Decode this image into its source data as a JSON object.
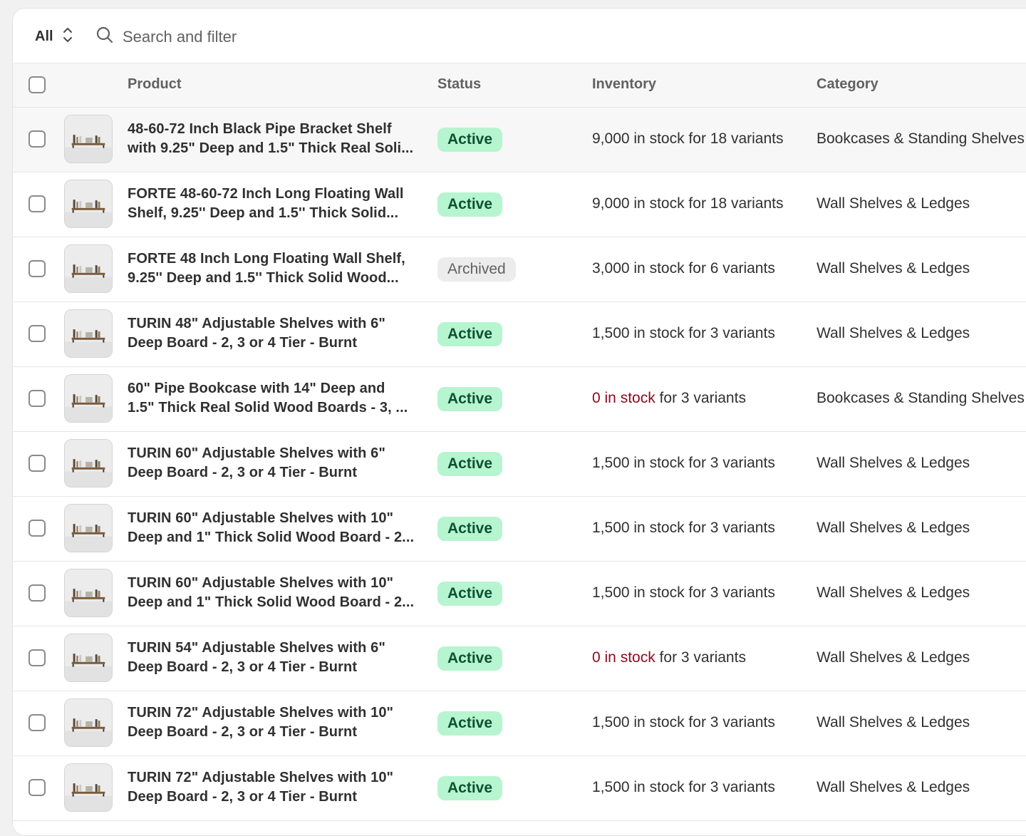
{
  "toolbar": {
    "view_label": "All",
    "search_placeholder": "Search and filter"
  },
  "table": {
    "headers": {
      "product": "Product",
      "status": "Status",
      "inventory": "Inventory",
      "category": "Category"
    },
    "rows": [
      {
        "title_line1": "48-60-72 Inch Black Pipe Bracket Shelf",
        "title_line2": "with 9.25\" Deep and 1.5\" Thick Real Soli...",
        "status": "Active",
        "stock": "9,000 in stock",
        "variants": " for 18 variants",
        "category": "Bookcases & Standing Shelves"
      },
      {
        "title_line1": "FORTE 48-60-72 Inch Long Floating Wall",
        "title_line2": "Shelf, 9.25'' Deep and 1.5'' Thick Solid...",
        "status": "Active",
        "stock": "9,000 in stock",
        "variants": " for 18 variants",
        "category": "Wall Shelves & Ledges"
      },
      {
        "title_line1": "FORTE 48 Inch Long Floating Wall Shelf,",
        "title_line2": "9.25'' Deep and 1.5'' Thick Solid Wood...",
        "status": "Archived",
        "stock": "3,000 in stock",
        "variants": " for 6 variants",
        "category": "Wall Shelves & Ledges"
      },
      {
        "title_line1": "TURIN 48\" Adjustable Shelves with 6\"",
        "title_line2": "Deep Board - 2, 3 or 4 Tier - Burnt",
        "status": "Active",
        "stock": "1,500 in stock",
        "variants": " for 3 variants",
        "category": "Wall Shelves & Ledges"
      },
      {
        "title_line1": "60\" Pipe Bookcase with 14\" Deep and",
        "title_line2": "1.5\" Thick Real Solid Wood Boards - 3, ...",
        "status": "Active",
        "stock": "0 in stock",
        "variants": " for 3 variants",
        "category": "Bookcases & Standing Shelves"
      },
      {
        "title_line1": "TURIN 60\" Adjustable Shelves with 6\"",
        "title_line2": "Deep Board - 2, 3 or 4 Tier - Burnt",
        "status": "Active",
        "stock": "1,500 in stock",
        "variants": " for 3 variants",
        "category": "Wall Shelves & Ledges"
      },
      {
        "title_line1": "TURIN 60\" Adjustable Shelves with 10\"",
        "title_line2": "Deep and 1\" Thick Solid Wood Board - 2...",
        "status": "Active",
        "stock": "1,500 in stock",
        "variants": " for 3 variants",
        "category": "Wall Shelves & Ledges"
      },
      {
        "title_line1": "TURIN 60\" Adjustable Shelves with 10\"",
        "title_line2": "Deep and 1\" Thick Solid Wood Board - 2...",
        "status": "Active",
        "stock": "1,500 in stock",
        "variants": " for 3 variants",
        "category": "Wall Shelves & Ledges"
      },
      {
        "title_line1": "TURIN 54\" Adjustable Shelves with 6\"",
        "title_line2": "Deep Board - 2, 3 or 4 Tier - Burnt",
        "status": "Active",
        "stock": "0 in stock",
        "variants": " for 3 variants",
        "category": "Wall Shelves & Ledges"
      },
      {
        "title_line1": "TURIN 72\" Adjustable Shelves with 10\"",
        "title_line2": "Deep Board - 2, 3 or 4 Tier - Burnt",
        "status": "Active",
        "stock": "1,500 in stock",
        "variants": " for 3 variants",
        "category": "Wall Shelves & Ledges"
      },
      {
        "title_line1": "TURIN 72\" Adjustable Shelves with 10\"",
        "title_line2": "Deep Board - 2, 3 or 4 Tier - Burnt",
        "status": "Active",
        "stock": "1,500 in stock",
        "variants": " for 3 variants",
        "category": "Wall Shelves & Ledges"
      }
    ]
  },
  "colors": {
    "active_badge_bg": "#b6f5cf",
    "active_badge_text": "#0c5132",
    "archived_badge_bg": "#ececec",
    "zero_stock_text": "#8e0b21"
  }
}
